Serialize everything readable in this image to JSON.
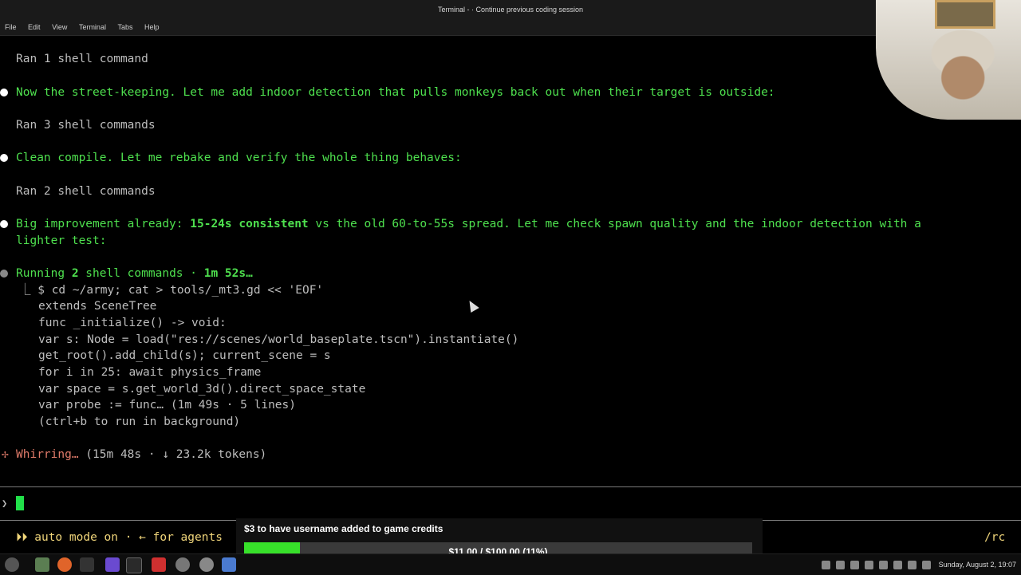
{
  "window": {
    "title": "Terminal -  ·  Continue previous coding session"
  },
  "menu": [
    "File",
    "Edit",
    "View",
    "Terminal",
    "Tabs",
    "Help"
  ],
  "lines": {
    "ran1": "Ran 1 shell command",
    "msg1": "Now the street-keeping. Let me add indoor detection that pulls monkeys back out when their target is outside:",
    "ran3": "Ran 3 shell commands",
    "msg2": "Clean compile. Let me rebake and verify the whole thing behaves:",
    "ran2": "Ran 2 shell commands",
    "msg3a_pre": "Big improvement already: ",
    "msg3a_bold": "15-24s consistent",
    "msg3a_post": " vs the old 60-to-55s spread. Let me check spawn quality and the indoor detection with a",
    "msg3b": "lighter test:",
    "running_pre": "Running ",
    "running_num": "2",
    "running_mid": " shell commands · ",
    "running_time": "1m 52s…",
    "cmd": "⎿ $ cd ~/army; cat > tools/_mt3.gd << 'EOF'",
    "code1": "extends SceneTree",
    "code2": "func _initialize() -> void:",
    "code3": "var s: Node = load(\"res://scenes/world_baseplate.tscn\").instantiate()",
    "code4": "get_root().add_child(s); current_scene = s",
    "code5": "for i in 25: await physics_frame",
    "code6": "var space = s.get_world_3d().direct_space_state",
    "code7": "var probe := func… (1m 49s · 5 lines)",
    "code8": "(ctrl+b to run in background)",
    "whir_glyph": "✢",
    "whir_word": "Whirring…",
    "whir_stats": " (15m 48s · ↓ 23.2k tokens)"
  },
  "prompt": {
    "caret": "❯"
  },
  "status": {
    "automode": "⏵⏵ auto mode on · ← for agents",
    "rc": "/rc"
  },
  "overlay": {
    "title": "$3 to have username added to game credits",
    "amount": "$11.00 / $100.00 (11%)",
    "progress": 0.11
  },
  "taskbar": {
    "clock": "Sunday, August  2, 19:07"
  },
  "colors": {
    "accent_green": "#4ee04e",
    "cursor": "#21e04a",
    "progress": "#37e02a"
  }
}
